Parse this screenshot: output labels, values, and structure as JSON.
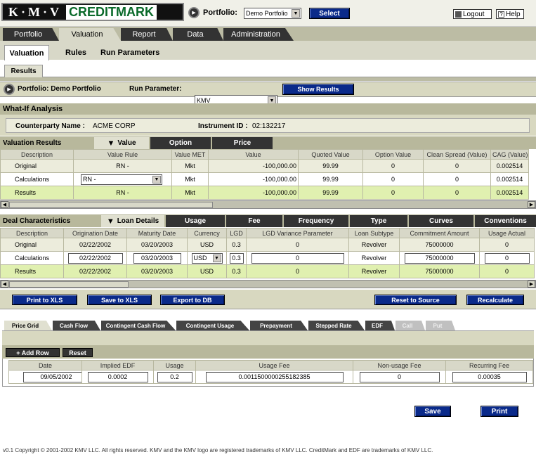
{
  "header": {
    "logo_kmv": "K·M·V",
    "logo_credit": "CREDITMARK",
    "portfolio_label": "Portfolio:",
    "portfolio_value": "Demo Portfolio",
    "select_label": "Select",
    "logout_label": "Logout",
    "help_label": "Help"
  },
  "main_tabs": [
    "Portfolio",
    "Valuation",
    "Report",
    "Data",
    "Administration"
  ],
  "sub_tabs": [
    "Valuation",
    "Rules",
    "Run Parameters"
  ],
  "sub_sub_tab": "Results",
  "run_bar": {
    "portfolio_text": "Portfolio: Demo Portfolio",
    "run_param_label": "Run Parameter:",
    "run_param_value": "KMV",
    "show_results_label": "Show Results"
  },
  "whatif": {
    "title": "What-If Analysis",
    "counterparty_label": "Counterparty Name :",
    "counterparty_value": "ACME CORP",
    "instrument_label": "Instrument ID :",
    "instrument_value": "02:132217"
  },
  "valuation_results": {
    "title": "Valuation Results",
    "tabs": [
      "Value",
      "Option",
      "Price"
    ],
    "columns": [
      "Description",
      "Value Rule",
      "Value MET",
      "Value",
      "Quoted Value",
      "Option Value",
      "Clean Spread (Value)",
      "CAG (Value)"
    ],
    "rows": [
      {
        "desc": "Original",
        "rule": "RN -",
        "met": "Mkt",
        "value": "-100,000.00",
        "quoted": "99.99",
        "option": "0",
        "spread": "0",
        "cag": "0.002514"
      },
      {
        "desc": "Calculations",
        "rule": "RN -",
        "met": "Mkt",
        "value": "-100,000.00",
        "quoted": "99.99",
        "option": "0",
        "spread": "0",
        "cag": "0.002514"
      },
      {
        "desc": "Results",
        "rule": "RN -",
        "met": "Mkt",
        "value": "-100,000.00",
        "quoted": "99.99",
        "option": "0",
        "spread": "0",
        "cag": "0.002514"
      }
    ]
  },
  "deal": {
    "title": "Deal Characteristics",
    "tabs": [
      "Loan Details",
      "Usage",
      "Fee",
      "Frequency",
      "Type",
      "Curves",
      "Conventions"
    ],
    "columns": [
      "Description",
      "Origination Date",
      "Maturity Date",
      "Currency",
      "LGD",
      "LGD Variance Parameter",
      "Loan Subtype",
      "Commitment Amount",
      "Usage Actual"
    ],
    "rows": [
      {
        "desc": "Original",
        "orig": "02/22/2002",
        "mat": "03/20/2003",
        "cur": "USD",
        "lgd": "0.3",
        "lgdv": "0",
        "sub": "Revolver",
        "commit": "75000000",
        "usage": "0"
      },
      {
        "desc": "Calculations",
        "orig": "02/22/2002",
        "mat": "03/20/2003",
        "cur": "USD",
        "lgd": "0.3",
        "lgdv": "0",
        "sub": "Revolver",
        "commit": "75000000",
        "usage": "0"
      },
      {
        "desc": "Results",
        "orig": "02/22/2002",
        "mat": "03/20/2003",
        "cur": "USD",
        "lgd": "0.3",
        "lgdv": "0",
        "sub": "Revolver",
        "commit": "75000000",
        "usage": "0"
      }
    ]
  },
  "action_buttons": {
    "print_xls": "Print to XLS",
    "save_xls": "Save to XLS",
    "export_db": "Export to DB",
    "reset_source": "Reset to Source",
    "recalculate": "Recalculate"
  },
  "bottom_tabs": [
    "Price Grid",
    "Cash Flow",
    "Contingent Cash Flow",
    "Contingent Usage",
    "Prepayment",
    "Stepped Rate",
    "EDF",
    "Call",
    "Put"
  ],
  "price_grid": {
    "add_row": "+ Add Row",
    "reset": "Reset",
    "columns": [
      "Date",
      "Implied EDF",
      "Usage",
      "Usage Fee",
      "Non-usage Fee",
      "Recurring Fee"
    ],
    "row": {
      "date": "09/05/2002",
      "edf": "0.0002",
      "usage": "0.2",
      "usage_fee": "0.0011500000255182385",
      "nonusage_fee": "0",
      "recurring_fee": "0.00035"
    }
  },
  "footer": {
    "save": "Save",
    "print": "Print",
    "copyright": "v0.1 Copyright © 2001-2002 KMV LLC. All rights reserved. KMV and the KMV logo are registered trademarks of KMV LLC. CreditMark and EDF are trademarks of KMV LLC."
  }
}
